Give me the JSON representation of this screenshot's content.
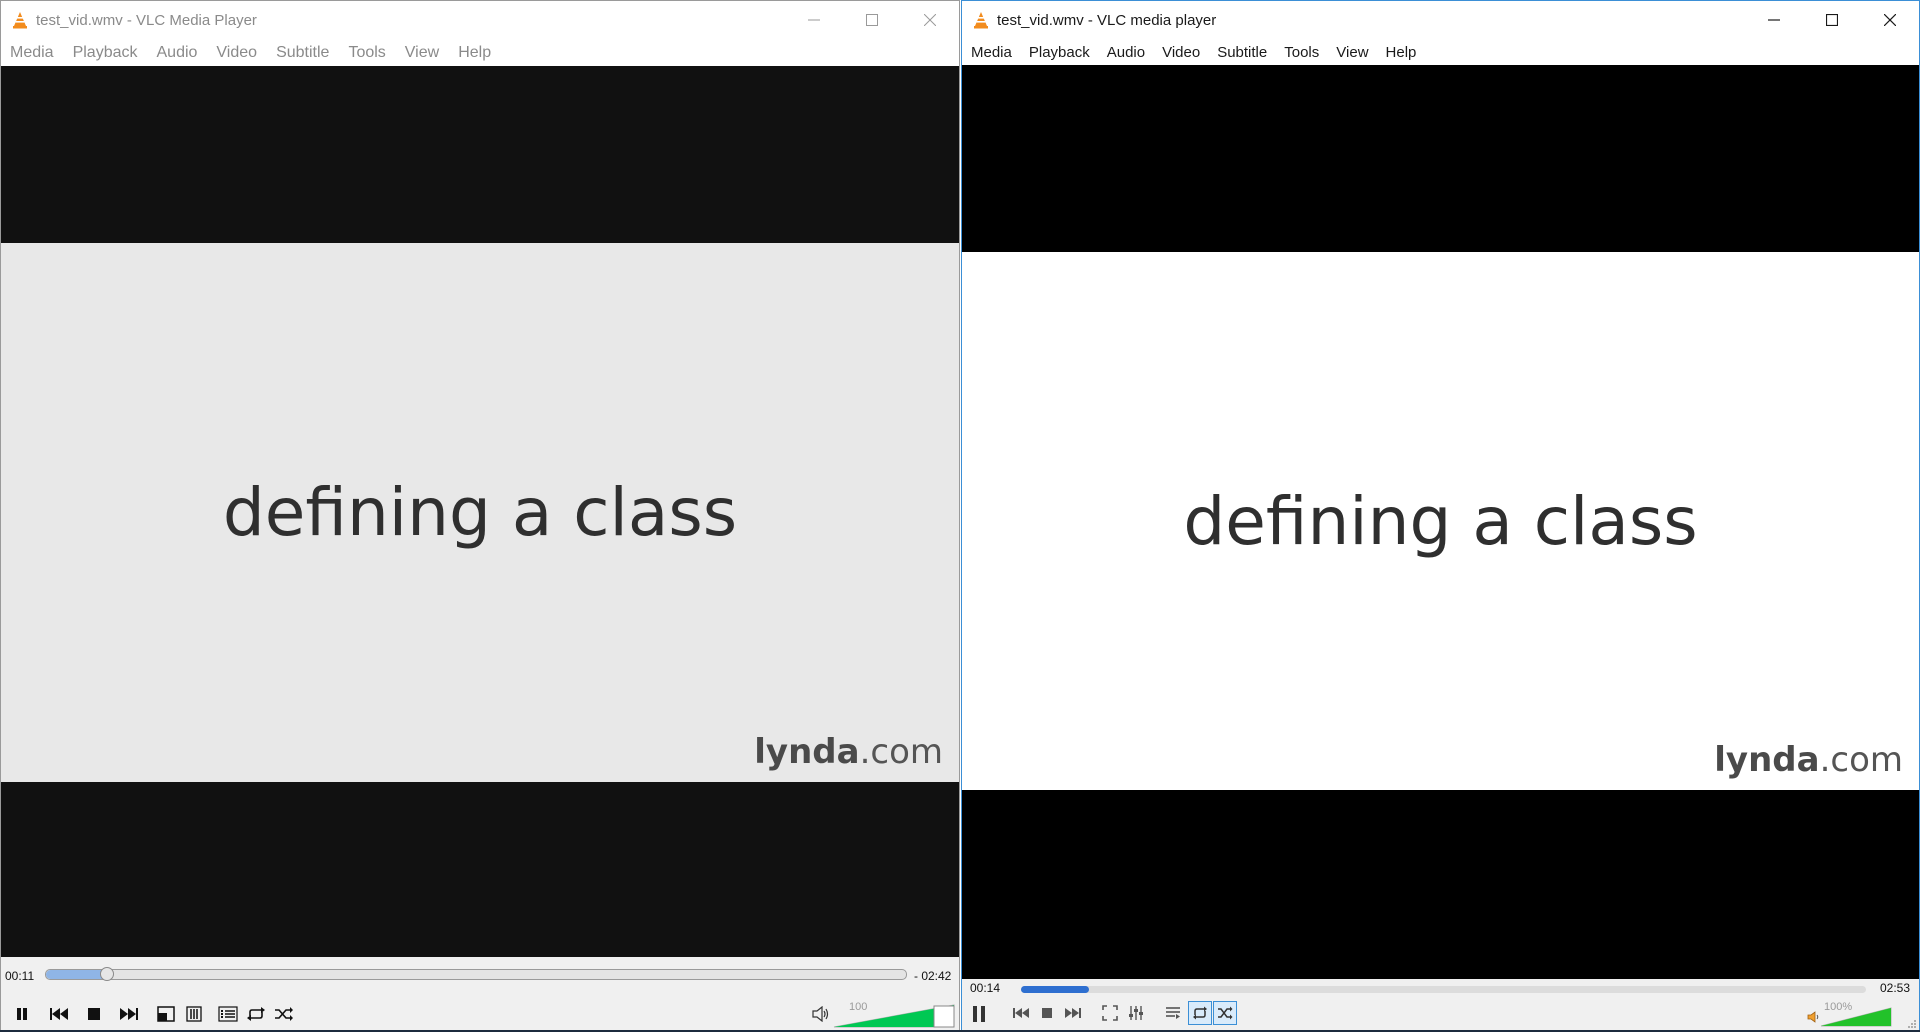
{
  "left_window": {
    "title": "test_vid.wmv - VLC Media Player",
    "menu": [
      "Media",
      "Playback",
      "Audio",
      "Video",
      "Subtitle",
      "Tools",
      "View",
      "Help"
    ],
    "video_text": "defining a class",
    "logo_bold": "lynda",
    "logo_rest": ".com",
    "time_elapsed": "00:11",
    "time_remaining": "- 02:42",
    "progress_fraction": 0.071,
    "volume_label": "100",
    "volume_fraction": 1.0,
    "icons": [
      "pause-icon",
      "previous-icon",
      "stop-icon",
      "next-icon",
      "fullscreen-icon",
      "extended-settings-icon",
      "playlist-icon",
      "loop-icon",
      "random-icon",
      "speaker-icon"
    ],
    "colors": {
      "seek_fill": "#8fb5e6",
      "volume": "#00c853"
    }
  },
  "right_window": {
    "title": "test_vid.wmv - VLC media player",
    "menu": [
      "Media",
      "Playback",
      "Audio",
      "Video",
      "Subtitle",
      "Tools",
      "View",
      "Help"
    ],
    "video_text": "defining a class",
    "logo_bold": "lynda",
    "logo_rest": ".com",
    "time_elapsed": "00:14",
    "time_total": "02:53",
    "progress_fraction": 0.081,
    "volume_label": "100%",
    "volume_fraction": 1.0,
    "icons": [
      "pause-icon",
      "previous-icon",
      "stop-icon",
      "next-icon",
      "fullscreen-icon",
      "extended-settings-icon",
      "playlist-icon",
      "loop-icon",
      "random-icon",
      "speaker-icon"
    ],
    "colors": {
      "seek_fill": "#2e6fd0",
      "volume": "#22c22a",
      "accent": "#3b8fd6"
    }
  }
}
